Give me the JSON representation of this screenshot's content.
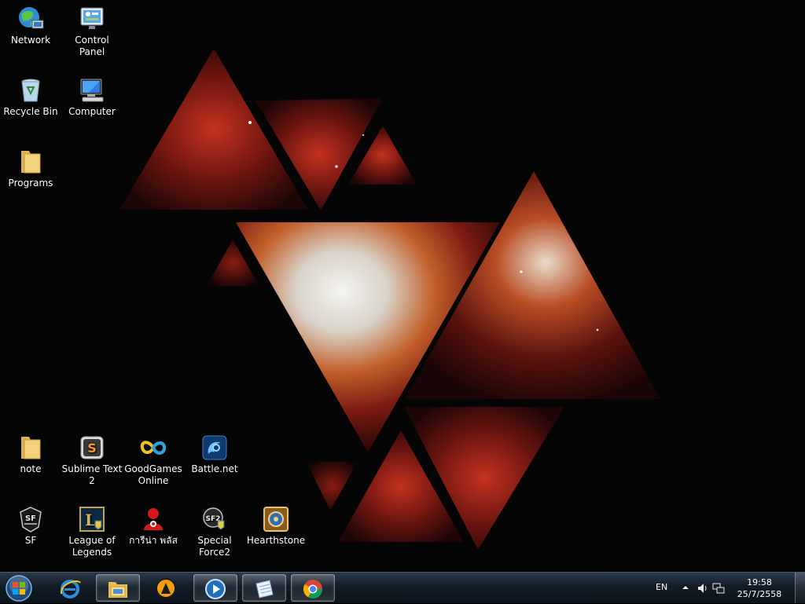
{
  "desktop_icons": [
    {
      "label": "Network",
      "icon": "network-icon"
    },
    {
      "label": "Control Panel",
      "icon": "control-panel-icon"
    },
    {
      "label": "Recycle Bin",
      "icon": "recycle-bin-icon"
    },
    {
      "label": "Computer",
      "icon": "computer-icon"
    },
    {
      "label": "Programs",
      "icon": "folder-icon"
    },
    {
      "label": "note",
      "icon": "folder-icon"
    },
    {
      "label": "Sublime Text 2",
      "icon": "sublime-text-icon"
    },
    {
      "label": "GoodGames Online",
      "icon": "goodgames-icon"
    },
    {
      "label": "Battle.net",
      "icon": "battlenet-icon"
    },
    {
      "label": "SF",
      "icon": "sf-icon"
    },
    {
      "label": "League of Legends",
      "icon": "league-of-legends-icon"
    },
    {
      "label": "การีน่า พลัส",
      "icon": "garena-plus-icon"
    },
    {
      "label": "Special Force2",
      "icon": "special-force2-icon"
    },
    {
      "label": "Hearthstone",
      "icon": "hearthstone-icon"
    }
  ],
  "taskbar": {
    "pinned": [
      {
        "icon": "internet-explorer-icon"
      },
      {
        "icon": "windows-explorer-icon"
      },
      {
        "icon": "aimp-player-icon"
      },
      {
        "icon": "media-player-icon"
      },
      {
        "icon": "notepad-icon"
      },
      {
        "icon": "chrome-icon"
      }
    ],
    "tray": {
      "language": "EN",
      "time": "19:58",
      "date": "25/7/2558"
    }
  },
  "colors": {
    "taskbar": "#121c27",
    "wallpaper_bg": "#050505",
    "nebula_red": "#b5211a"
  }
}
